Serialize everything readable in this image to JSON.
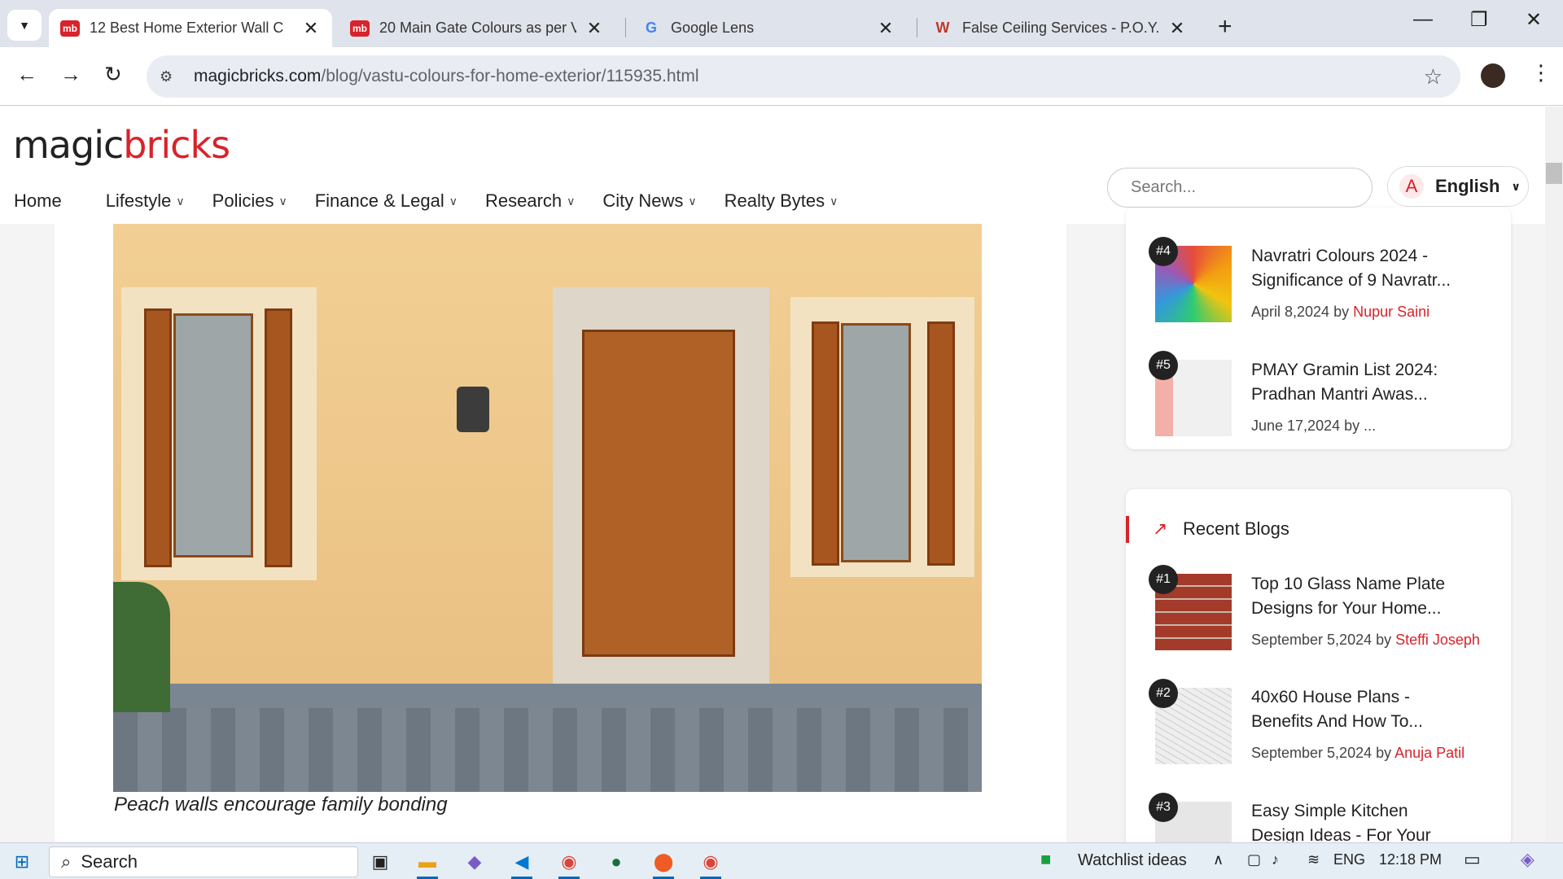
{
  "browser": {
    "tabs": [
      {
        "title": "12 Best Home Exterior Wall C",
        "fav": "mb",
        "fav_color": "#d8232a",
        "active": true
      },
      {
        "title": "20 Main Gate Colours as per V",
        "fav": "mb",
        "fav_color": "#d8232a",
        "active": false
      },
      {
        "title": "Google Lens",
        "fav": "G",
        "fav_color": "#4285f4",
        "active": false
      },
      {
        "title": "False Ceiling Services - P.O.Y. Bo",
        "fav": "W",
        "fav_color": "#c0392b",
        "active": false
      }
    ],
    "url_host": "magicbricks.com",
    "url_path": "/blog/vastu-colours-for-home-exterior/115935.html"
  },
  "site": {
    "logo_a": "magic",
    "logo_b": "bricks",
    "nav": [
      "Home",
      "Lifestyle",
      "Policies",
      "Finance & Legal",
      "Research",
      "City News",
      "Realty Bytes"
    ],
    "search_placeholder": "Search...",
    "lang_icon": "A",
    "lang": "English"
  },
  "article": {
    "caption": "Peach walls encourage family bonding"
  },
  "sidebar": {
    "top": [
      {
        "rank": "#4",
        "title1": "Navratri Colours 2024 -",
        "title2": "Significance of 9 Navratr...",
        "date": "April 8,2024 by ",
        "author": "Nupur Saini"
      },
      {
        "rank": "#5",
        "title1": "PMAY Gramin List 2024:",
        "title2": "Pradhan Mantri Awas...",
        "date": "June 17,2024 by ...",
        "author": ""
      }
    ],
    "recent_heading": "Recent Blogs",
    "recent": [
      {
        "rank": "#1",
        "title1": "Top 10 Glass Name Plate",
        "title2": "Designs for Your Home...",
        "date": "September 5,2024 by ",
        "author": "Steffi Joseph"
      },
      {
        "rank": "#2",
        "title1": "40x60 House Plans -",
        "title2": "Benefits And How To...",
        "date": "September 5,2024 by ",
        "author": "Anuja Patil"
      },
      {
        "rank": "#3",
        "title1": "Easy Simple Kitchen",
        "title2": "Design Ideas - For Your",
        "date": "",
        "author": ""
      }
    ]
  },
  "taskbar": {
    "search": "Search",
    "watchlist": "Watchlist ideas",
    "lang": "ENG",
    "time": "12:18 PM"
  }
}
